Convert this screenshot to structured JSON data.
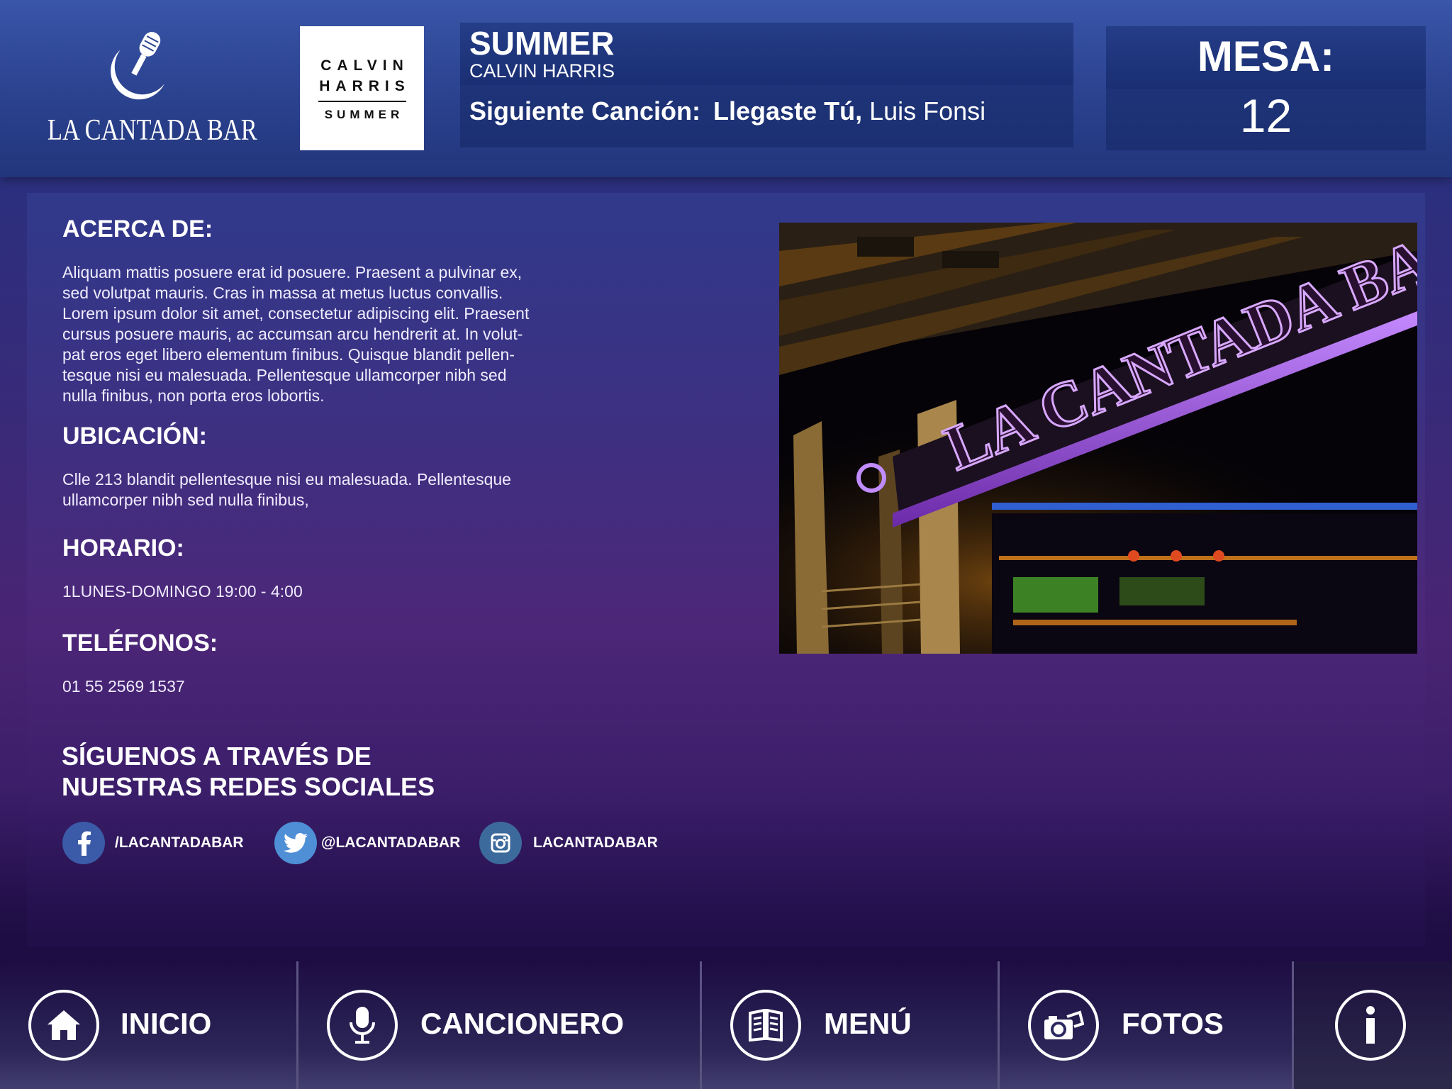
{
  "brand": {
    "name": "LA CANTADA BAR",
    "logo_icon": "microphone-moon-icon"
  },
  "album": {
    "line1": "CALVIN",
    "line2": "HARRIS",
    "line3": "SUMMER"
  },
  "now_playing": {
    "title": "SUMMER",
    "artist": "CALVIN HARRIS",
    "next_label": "Siguiente Canción:",
    "next_song": "Llegaste Tú,",
    "next_artist": "Luis Fonsi"
  },
  "mesa": {
    "label": "MESA:",
    "number": "12"
  },
  "about": {
    "heading": "ACERCA DE:",
    "lines": [
      "Aliquam mattis posuere erat id posuere. Praesent a pulvinar ex,",
      "sed volutpat mauris. Cras in massa at metus luctus convallis.",
      "Lorem ipsum dolor sit amet, consectetur adipiscing elit. Praesent",
      "cursus posuere mauris, ac accumsan arcu hendrerit at. In volut-",
      "pat eros eget libero elementum finibus. Quisque blandit pellen-",
      "tesque nisi eu malesuada. Pellentesque ullamcorper nibh sed",
      "nulla finibus, non porta eros lobortis."
    ]
  },
  "location": {
    "heading": "UBICACIÓN:",
    "lines": [
      "Clle 213 blandit pellentesque nisi eu malesuada. Pellentesque",
      "ullamcorper nibh sed nulla finibus,"
    ]
  },
  "schedule": {
    "heading": "HORARIO:",
    "text": "1LUNES-DOMINGO 19:00 - 4:00"
  },
  "phones": {
    "heading": "TELÉFONOS:",
    "text": "01 55 2569 1537"
  },
  "social": {
    "heading_line1": "SÍGUENOS A TRAVÉS DE",
    "heading_line2": "NUESTRAS REDES SOCIALES",
    "items": [
      {
        "icon": "facebook-icon",
        "label": "/LACANTADABAR",
        "color": "#3b5ba8"
      },
      {
        "icon": "twitter-icon",
        "label": "@LACANTADABAR",
        "color": "#4e8fd6"
      },
      {
        "icon": "instagram-icon",
        "label": "LACANTADABAR",
        "color": "#3d6a9c"
      }
    ]
  },
  "photo": {
    "sign_text": "LA CANTADA BAR"
  },
  "nav": {
    "items": [
      {
        "icon": "home-icon",
        "label": "INICIO"
      },
      {
        "icon": "microphone-icon",
        "label": "CANCIONERO"
      },
      {
        "icon": "menu-book-icon",
        "label": "MENÚ"
      },
      {
        "icon": "camera-icon",
        "label": "FOTOS"
      },
      {
        "icon": "info-icon",
        "label": ""
      }
    ]
  },
  "colors": {
    "header_blue": "#2d4593",
    "panel_purple": "#4a2474",
    "accent_white": "#ffffff"
  }
}
